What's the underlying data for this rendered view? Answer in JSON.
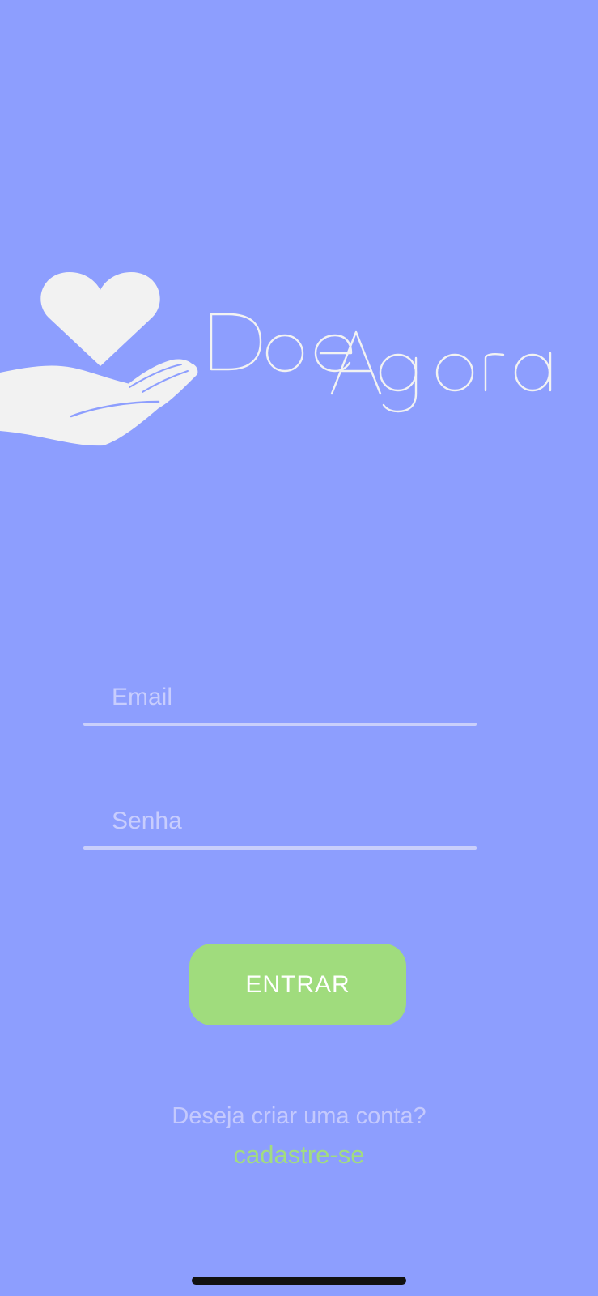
{
  "colors": {
    "background": "#8d9efe",
    "logo_white": "#f2f2f2",
    "field_underline": "#c9cffb",
    "field_placeholder": "#c8cdfd",
    "button_green": "#a0dc7d",
    "button_text": "#ffffff",
    "prompt_text": "#c4c9fd",
    "link_green": "#a2dc80",
    "home_indicator": "#111111"
  },
  "logo": {
    "brand_name": "DoeAgora",
    "icon": "heart-in-hand-icon"
  },
  "login_form": {
    "email_placeholder": "Email",
    "email_value": "",
    "password_placeholder": "Senha",
    "password_value": "",
    "submit_label": "ENTRAR"
  },
  "signup": {
    "prompt": "Deseja criar uma conta?",
    "link_label": "cadastre-se"
  }
}
